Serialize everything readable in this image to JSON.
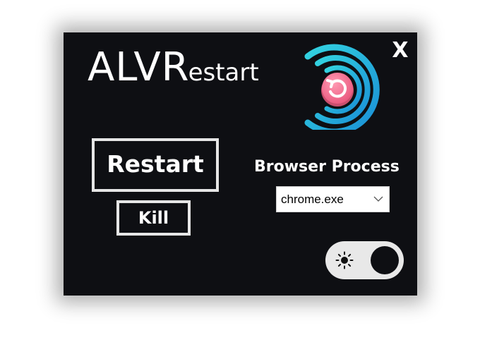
{
  "app": {
    "title_big": "ALVR",
    "title_small": "estart",
    "close_label": "X"
  },
  "buttons": {
    "restart_label": "Restart",
    "kill_label": "Kill"
  },
  "browser_process": {
    "label": "Browser Process",
    "selected": "chrome.exe"
  },
  "theme_toggle": {
    "icon": "sun-icon",
    "state": "dark"
  },
  "logo": {
    "icon": "restart-logo-icon",
    "ring_color": "#3fc6e0",
    "center_color": "#f26f8f"
  },
  "colors": {
    "background": "#0e0f13",
    "text": "#ffffff",
    "border": "#e6e6e6",
    "toggle_track": "#e8e8e8"
  }
}
